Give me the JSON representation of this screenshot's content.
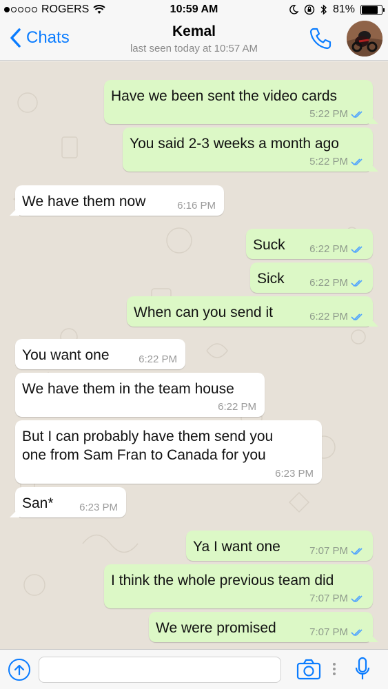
{
  "status_bar": {
    "carrier": "ROGERS",
    "time": "10:59 AM",
    "battery": "81%",
    "battery_level": 0.81
  },
  "nav": {
    "back_label": "Chats",
    "contact_name": "Kemal",
    "last_seen": "last seen today at 10:57 AM"
  },
  "messages": [
    {
      "dir": "out",
      "text": "Have we been sent the video cards",
      "time": "5:22 PM",
      "read": true
    },
    {
      "dir": "out",
      "text": "You said 2-3 weeks a month ago",
      "time": "5:22 PM",
      "read": true
    },
    {
      "dir": "in",
      "text": "We have them now",
      "time": "6:16 PM"
    },
    {
      "dir": "out",
      "text": "Suck",
      "time": "6:22 PM",
      "read": true
    },
    {
      "dir": "out",
      "text": "Sick",
      "time": "6:22 PM",
      "read": true
    },
    {
      "dir": "out",
      "text": "When can you send it",
      "time": "6:22 PM",
      "read": true
    },
    {
      "dir": "in",
      "text": "You want one",
      "time": "6:22 PM"
    },
    {
      "dir": "in",
      "text": "We have them in the team house",
      "time": "6:22 PM"
    },
    {
      "dir": "in",
      "text": "But I can probably have them send you",
      "text2": "one from Sam Fran to Canada for you",
      "time": "6:23 PM"
    },
    {
      "dir": "in",
      "text": "San*",
      "time": "6:23 PM"
    },
    {
      "dir": "out",
      "text": "Ya I want one",
      "time": "7:07 PM",
      "read": true
    },
    {
      "dir": "out",
      "text": "I think the whole previous team did",
      "time": "7:07 PM",
      "read": true
    },
    {
      "dir": "out",
      "text": "We were promised",
      "time": "7:07 PM",
      "read": true
    }
  ],
  "input": {
    "placeholder": ""
  },
  "icons": {
    "back": "chevron-left-icon",
    "call": "phone-icon",
    "upload": "arrow-up-icon",
    "camera": "camera-icon",
    "mic": "microphone-icon",
    "read_receipt": "double-check-icon"
  },
  "colors": {
    "accent": "#0a7cff",
    "outgoing_bubble": "#dcf8c6",
    "incoming_bubble": "#ffffff",
    "chat_background": "#e7e1d8",
    "read_ticks": "#4fa3ff"
  }
}
